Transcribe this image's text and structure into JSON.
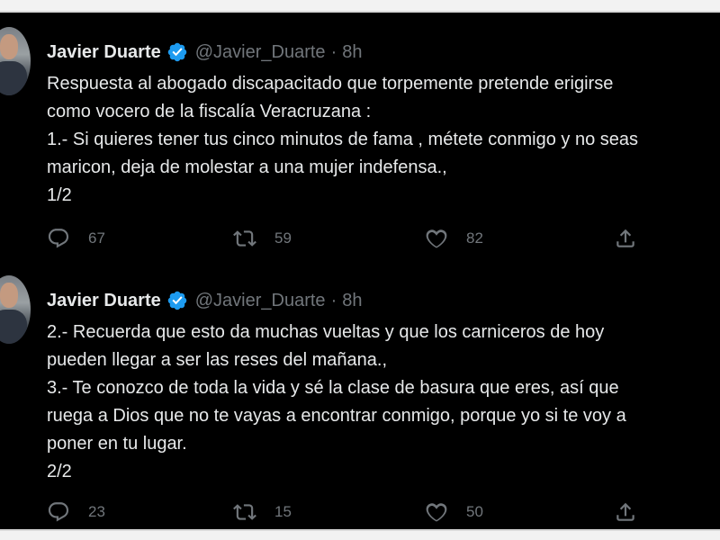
{
  "tweets": [
    {
      "author_name": "Javier Duarte",
      "handle": "@Javier_Duarte",
      "separator": "·",
      "time": "8h",
      "lines": [
        "Respuesta al abogado discapacitado que torpemente pretende erigirse",
        "como vocero de la fiscalía Veracruzana :",
        "1.- Si quieres tener tus cinco minutos de fama , métete conmigo y no seas",
        "maricon, deja de molestar a una mujer indefensa.,",
        "1/2"
      ],
      "replies": "67",
      "retweets": "59",
      "likes": "82"
    },
    {
      "author_name": "Javier Duarte",
      "handle": "@Javier_Duarte",
      "separator": "·",
      "time": "8h",
      "lines": [
        "2.- Recuerda que esto da muchas vueltas y que los carniceros de hoy",
        "pueden llegar a ser las reses del mañana.,",
        "3.- Te conozco de toda la vida y sé la clase de basura que eres, así que",
        "ruega a Dios que no te vayas a encontrar conmigo, porque yo si te voy a",
        "poner en tu lugar.",
        "2/2"
      ],
      "replies": "23",
      "retweets": "15",
      "likes": "50"
    }
  ],
  "colors": {
    "background": "#000000",
    "text": "#e7e9ea",
    "muted": "#71767b",
    "verified": "#1d9bf0"
  },
  "icons": [
    "reply-icon",
    "retweet-icon",
    "like-icon",
    "share-icon",
    "verified-badge-icon"
  ]
}
